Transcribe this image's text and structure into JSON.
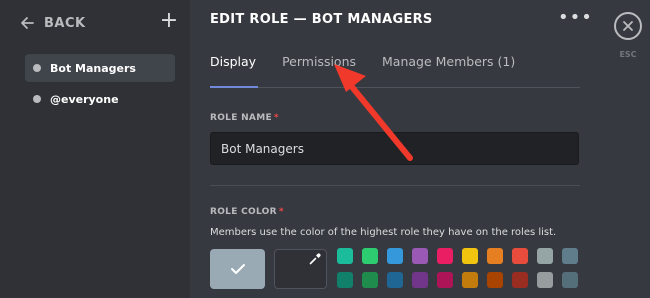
{
  "sidebar": {
    "back_label": "BACK",
    "roles": [
      {
        "label": "Bot Managers",
        "active": true
      },
      {
        "label": "@everyone",
        "active": false
      }
    ]
  },
  "header": {
    "title": "EDIT ROLE — BOT MANAGERS",
    "more_icon": "more-horizontal-icon"
  },
  "tabs": [
    {
      "label": "Display",
      "active": true
    },
    {
      "label": "Permissions",
      "active": false
    },
    {
      "label": "Manage Members (1)",
      "active": false
    }
  ],
  "role_name": {
    "label": "ROLE NAME",
    "required_mark": "*",
    "value": "Bot Managers"
  },
  "role_color": {
    "label": "ROLE COLOR",
    "required_mark": "*",
    "helper": "Members use the color of the highest role they have on the roles list.",
    "default_color": "#99aab5",
    "swatches": [
      "#1abc9c",
      "#2ecc71",
      "#3498db",
      "#9b59b6",
      "#e91e63",
      "#f1c40f",
      "#e67e22",
      "#e74c3c",
      "#95a5a6",
      "#607d8b",
      "#11806a",
      "#1f8b4c",
      "#206694",
      "#71368a",
      "#ad1457",
      "#c27c0e",
      "#a84300",
      "#992d22",
      "#979c9f",
      "#546e7a"
    ]
  },
  "close": {
    "icon": "close-icon",
    "esc_label": "ESC"
  },
  "annotation": {
    "arrow_color": "#f0392b"
  },
  "theme": {
    "accent": "#7289da",
    "background": "#36393f",
    "sidebar": "#2f3136"
  }
}
